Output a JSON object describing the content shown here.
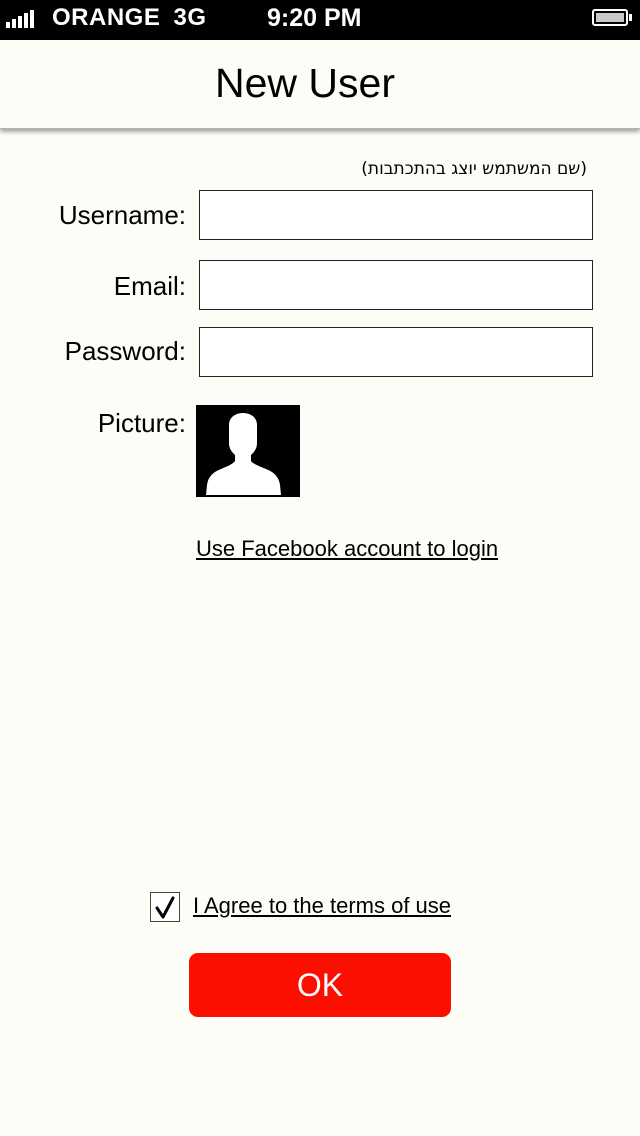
{
  "status_bar": {
    "carrier": "ORANGE",
    "network": "3G",
    "time": "9:20 PM",
    "signal_icon": "signal-bars-icon",
    "battery_icon": "battery-icon"
  },
  "header": {
    "title": "New User"
  },
  "form": {
    "username_hint": "(שם המשתמש יוצג בהתכתבות)",
    "username_label": "Username:",
    "username_value": "",
    "email_label": "Email:",
    "email_value": "",
    "password_label": "Password:",
    "password_value": "",
    "picture_label": "Picture:",
    "picture_icon": "user-silhouette-icon"
  },
  "facebook_link": "Use Facebook account to login",
  "terms": {
    "checked": true,
    "label": "I Agree to the terms of use",
    "check_icon": "checkmark-icon"
  },
  "ok_button": "OK",
  "colors": {
    "background": "#fdfdf7",
    "status_bar": "#000000",
    "ok_button": "#fb0f00",
    "ok_text": "#ffffff"
  }
}
